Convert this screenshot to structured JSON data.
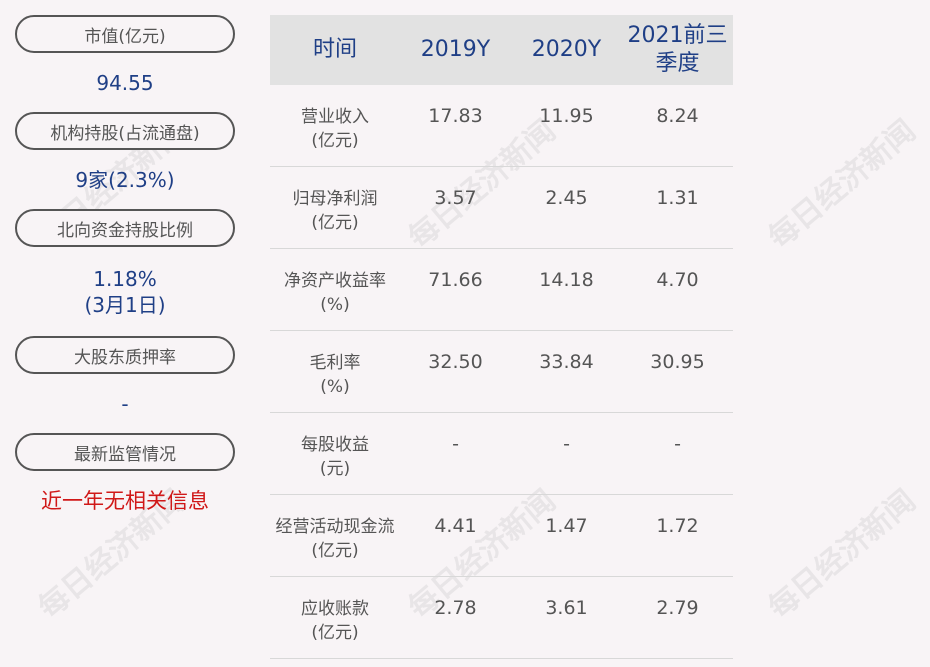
{
  "left_panel": [
    {
      "label": "市值(亿元)",
      "value": "94.55"
    },
    {
      "label": "机构持股(占流通盘)",
      "value": "9家(2.3%)"
    },
    {
      "label": "北向资金持股比例",
      "value": "1.18%",
      "value2": "(3月1日)"
    },
    {
      "label": "大股东质押率",
      "value": "-"
    },
    {
      "label": "最新监管情况",
      "value": "近一年无相关信息"
    }
  ],
  "table": {
    "headers": [
      "时间",
      "2019Y",
      "2020Y",
      "2021前三",
      "季度"
    ],
    "rows": [
      {
        "label1": "营业收入",
        "label2": "(亿元)",
        "v": [
          "17.83",
          "11.95",
          "8.24"
        ]
      },
      {
        "label1": "归母净利润",
        "label2": "(亿元)",
        "v": [
          "3.57",
          "2.45",
          "1.31"
        ]
      },
      {
        "label1": "净资产收益率",
        "label2": "(%)",
        "v": [
          "71.66",
          "14.18",
          "4.70"
        ]
      },
      {
        "label1": "毛利率",
        "label2": "(%)",
        "v": [
          "32.50",
          "33.84",
          "30.95"
        ]
      },
      {
        "label1": "每股收益",
        "label2": "(元)",
        "v": [
          "-",
          "-",
          "-"
        ]
      },
      {
        "label1": "经营活动现金流",
        "label2": "(亿元)",
        "v": [
          "4.41",
          "1.47",
          "1.72"
        ]
      },
      {
        "label1": "应收账款",
        "label2": "(亿元)",
        "v": [
          "2.78",
          "3.61",
          "2.79"
        ]
      }
    ]
  },
  "watermark": "每日经济新闻"
}
